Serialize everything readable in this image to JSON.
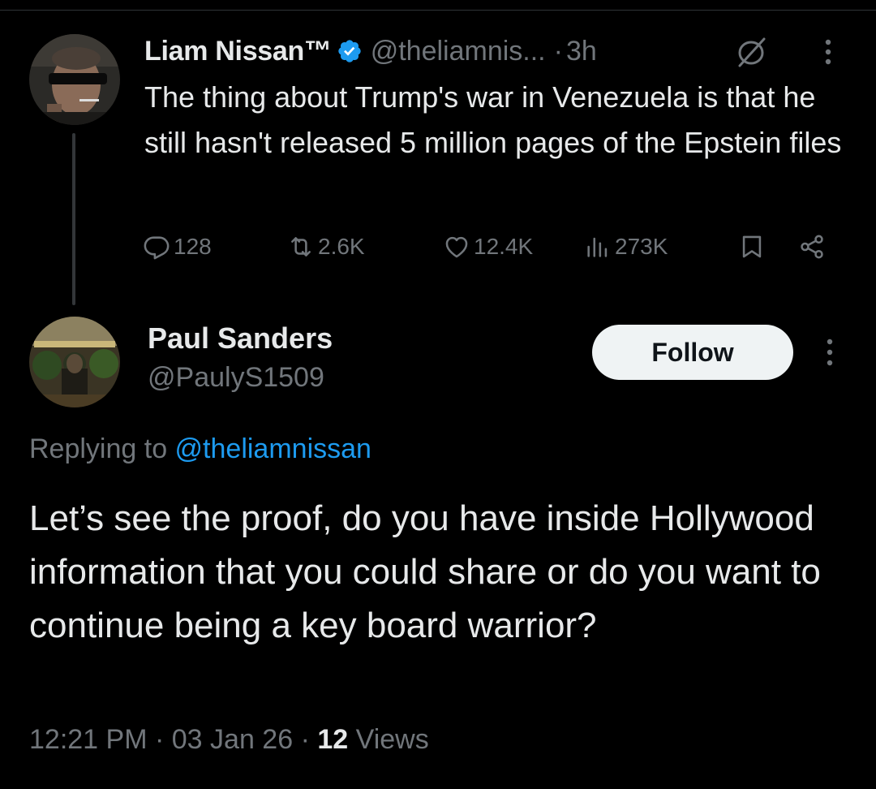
{
  "parent_tweet": {
    "author_name": "Liam Nissan™",
    "handle": "@theliamnis...",
    "dot": "·",
    "time": "3h",
    "text": "The thing about Trump's war in Venezuela is that he still hasn't released 5 million pages of the Epstein files",
    "replies": "128",
    "reposts": "2.6K",
    "likes": "12.4K",
    "views": "273K"
  },
  "reply_tweet": {
    "author_name": "Paul Sanders",
    "handle": "@PaulyS1509",
    "follow_label": "Follow",
    "replying_to_label": "Replying to ",
    "replying_to_handle": "@theliamnissan",
    "text": "Let’s see the proof, do you have inside Hollywood information that you could share or do you want to continue being a key board warrior?",
    "time": "12:21 PM",
    "sep": "·",
    "date": "03 Jan 26",
    "views_count": "12",
    "views_label": " Views"
  },
  "colors": {
    "background": "#000000",
    "primary_text": "#e7e9ea",
    "secondary_text": "#71767b",
    "link": "#1d9bf0",
    "verified": "#1d9bf0",
    "follow_bg": "#eff3f4"
  },
  "icons": [
    "verified-badge-icon",
    "no-distribution-icon",
    "more-icon",
    "reply-icon",
    "repost-icon",
    "like-icon",
    "views-icon",
    "bookmark-icon",
    "share-icon"
  ]
}
